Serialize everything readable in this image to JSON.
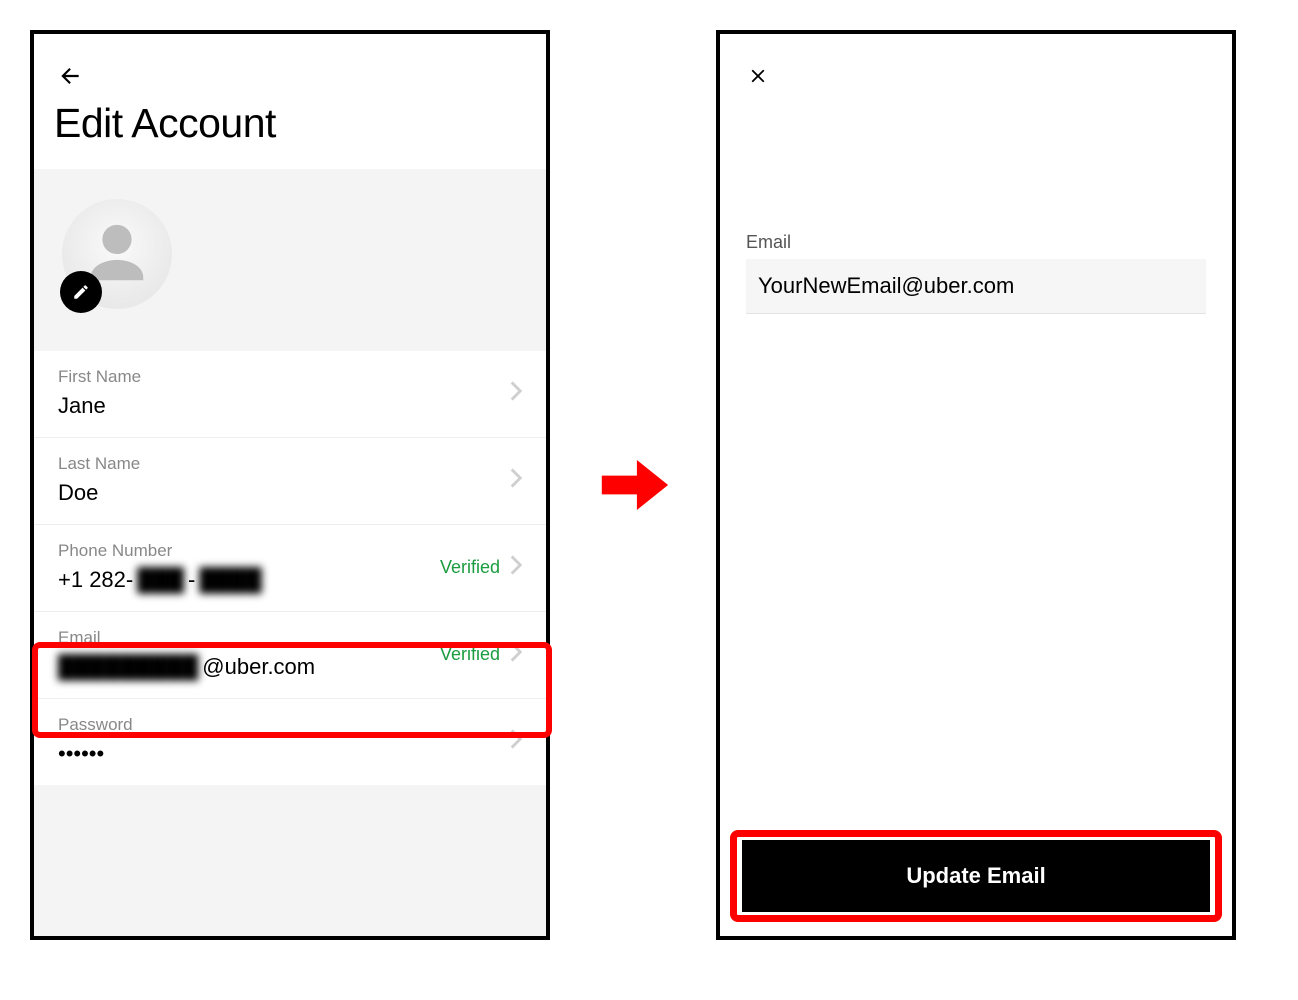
{
  "colors": {
    "verified": "#1a9c3f",
    "highlight": "#ff0000"
  },
  "leftScreen": {
    "title": "Edit Account",
    "fields": {
      "firstName": {
        "label": "First Name",
        "value": "Jane"
      },
      "lastName": {
        "label": "Last Name",
        "value": "Doe"
      },
      "phone": {
        "label": "Phone Number",
        "value_prefix": "+1 282-",
        "value_obscured_middle": "███",
        "value_dash": "-",
        "value_obscured_end": "████",
        "status": "Verified"
      },
      "email": {
        "label": "Email",
        "value_obscured_prefix": "█████████",
        "value_suffix": "@uber.com",
        "status": "Verified"
      },
      "password": {
        "label": "Password",
        "value": "••••••"
      }
    }
  },
  "rightScreen": {
    "emailLabel": "Email",
    "emailValue": "YourNewEmail@uber.com",
    "updateButton": "Update Email"
  }
}
